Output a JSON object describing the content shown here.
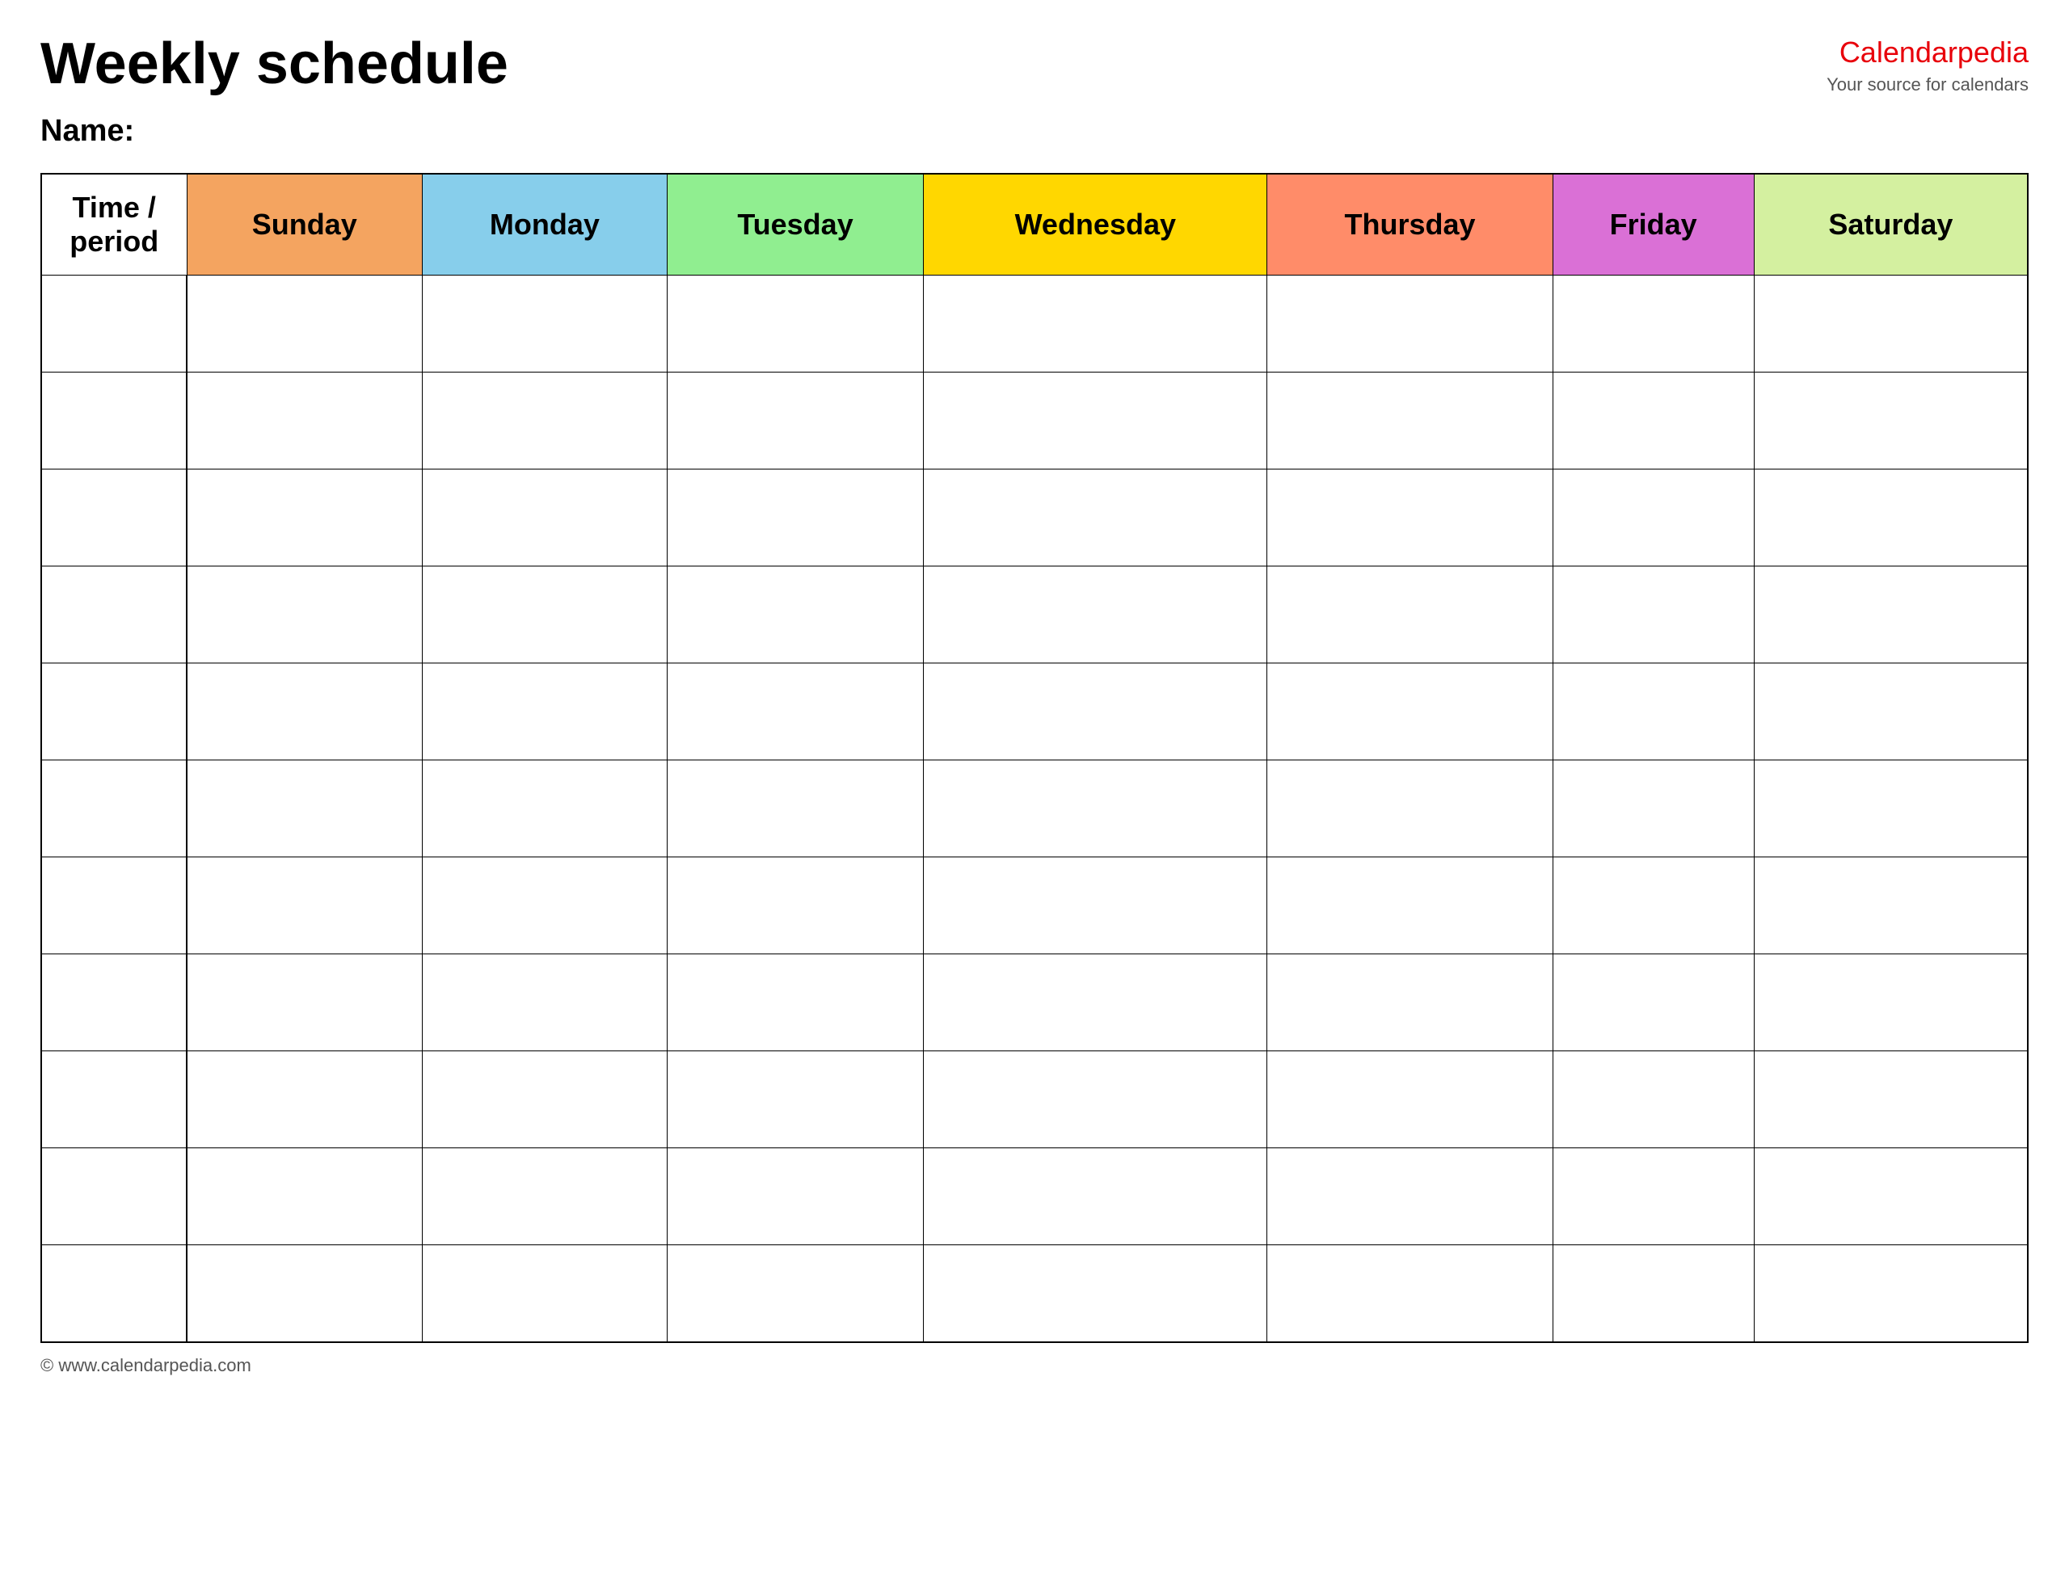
{
  "header": {
    "title": "Weekly schedule",
    "brand_name": "Calendar",
    "brand_name_accent": "pedia",
    "brand_tagline": "Your source for calendars"
  },
  "name_label": "Name:",
  "columns": [
    {
      "id": "time",
      "label": "Time / period",
      "color_class": "col-time"
    },
    {
      "id": "sunday",
      "label": "Sunday",
      "color_class": "col-sunday"
    },
    {
      "id": "monday",
      "label": "Monday",
      "color_class": "col-monday"
    },
    {
      "id": "tuesday",
      "label": "Tuesday",
      "color_class": "col-tuesday"
    },
    {
      "id": "wednesday",
      "label": "Wednesday",
      "color_class": "col-wednesday"
    },
    {
      "id": "thursday",
      "label": "Thursday",
      "color_class": "col-thursday"
    },
    {
      "id": "friday",
      "label": "Friday",
      "color_class": "col-friday"
    },
    {
      "id": "saturday",
      "label": "Saturday",
      "color_class": "col-saturday"
    }
  ],
  "num_rows": 11,
  "footer": {
    "url": "www.calendarpedia.com",
    "label": "© www.calendarpedia.com"
  }
}
